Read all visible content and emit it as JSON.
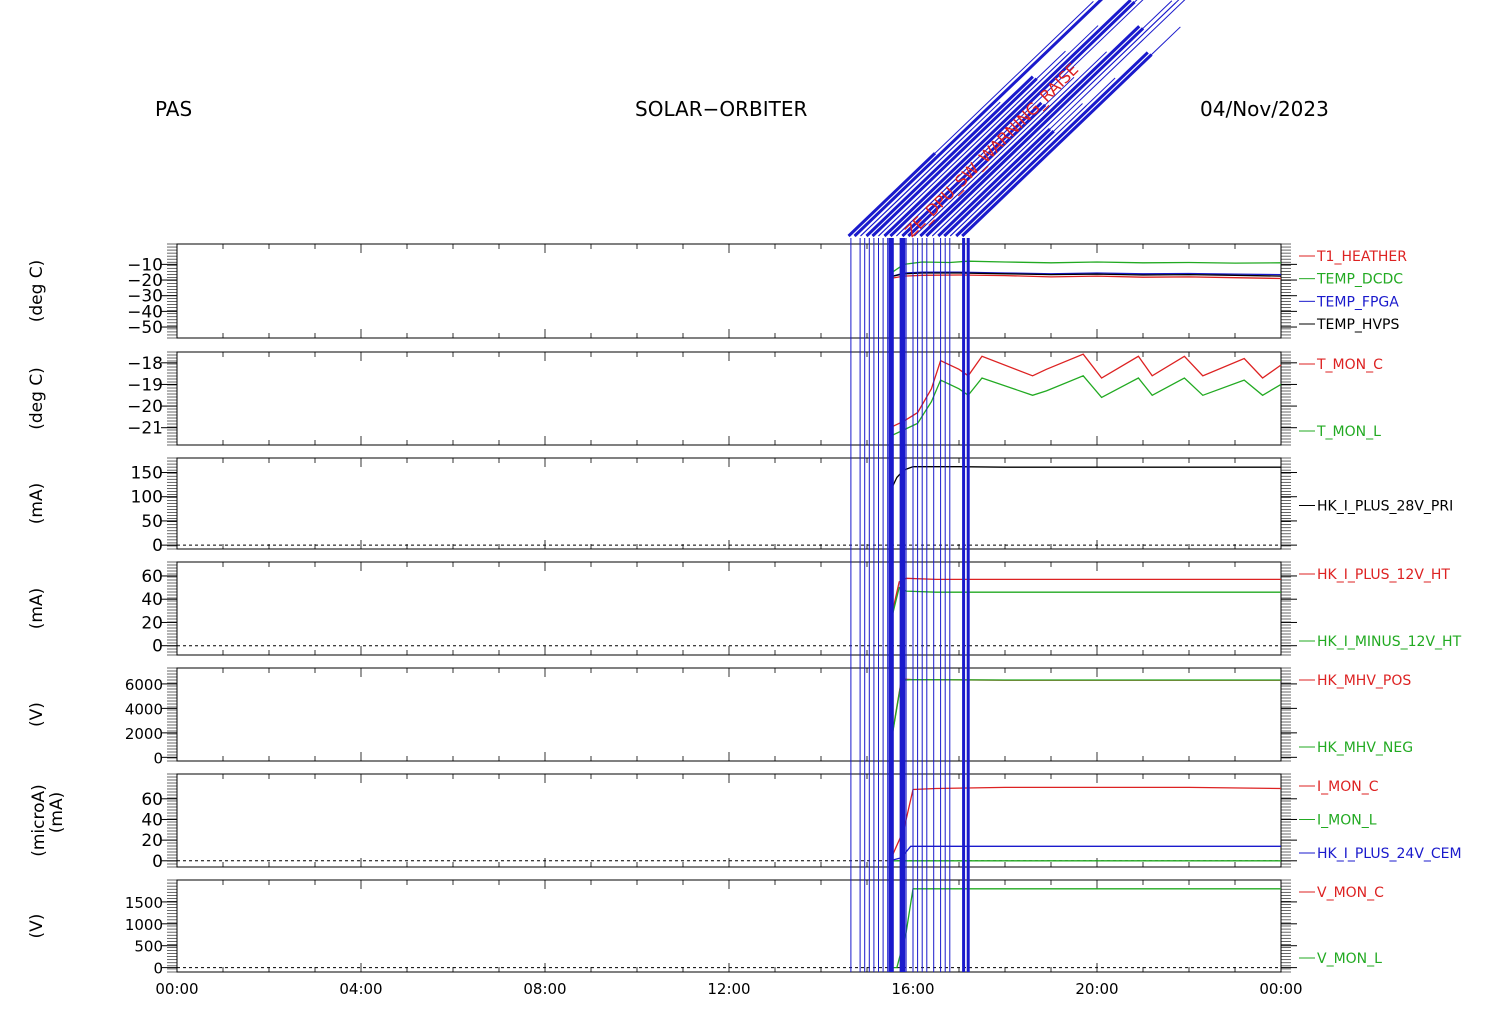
{
  "header": {
    "instrument": "PAS",
    "mission": "SOLAR−ORBITER",
    "date": "04/Nov/2023"
  },
  "colors": {
    "red": "#dd2222",
    "green": "#22aa22",
    "blue": "#1a1acc",
    "black": "#000000"
  },
  "event_labels": [
    {
      "time": 15.45,
      "text": "ZE_DPU_SW_WARNING_RAISE",
      "color": "red"
    }
  ],
  "event_lines": [
    14.65,
    14.85,
    14.95,
    15.05,
    15.15,
    15.25,
    15.35,
    15.45,
    15.55,
    15.72,
    15.85,
    16.0,
    16.1,
    16.2,
    16.3,
    16.45,
    16.6,
    16.7,
    16.8
  ],
  "event_lines_thick": [
    15.5,
    15.55,
    15.75,
    15.8,
    17.1,
    17.2
  ],
  "chart_data": [
    {
      "type": "line",
      "ylabel": "(deg C)",
      "ylim": [
        -57,
        3
      ],
      "yticks": [
        -10,
        -20,
        -30,
        -40,
        -50
      ],
      "ticklabels": [
        "−10",
        "−20",
        "−30",
        "−40",
        "−50"
      ],
      "xlim": [
        0,
        24
      ],
      "series": [
        {
          "name": "T1_HEATHER",
          "color": "red",
          "x": [
            15.5,
            15.8,
            16.2,
            17,
            18,
            19,
            20,
            21,
            22,
            23,
            24
          ],
          "y": [
            -19,
            -17.5,
            -17,
            -16.8,
            -17.2,
            -18,
            -17.5,
            -18.2,
            -18,
            -18.5,
            -19
          ]
        },
        {
          "name": "TEMP_DCDC",
          "color": "green",
          "x": [
            15.5,
            15.8,
            16.2,
            16.8,
            17.2,
            18,
            19,
            20,
            21,
            22,
            23,
            24
          ],
          "y": [
            -16,
            -10,
            -8.5,
            -8.8,
            -8,
            -8.5,
            -9,
            -8.5,
            -9,
            -8.8,
            -9.2,
            -9
          ]
        },
        {
          "name": "TEMP_FPGA",
          "color": "blue",
          "x": [
            15.5,
            15.8,
            16.2,
            17,
            18,
            19,
            20,
            21,
            22,
            23,
            24
          ],
          "y": [
            -18,
            -15.5,
            -15,
            -15,
            -15.5,
            -16,
            -15.5,
            -16,
            -15.8,
            -16.2,
            -16.5
          ]
        },
        {
          "name": "TEMP_HVPS",
          "color": "black",
          "x": [
            15.5,
            15.8,
            16.2,
            17,
            18,
            19,
            20,
            21,
            22,
            23,
            24
          ],
          "y": [
            -18,
            -16,
            -15.5,
            -15.5,
            -16,
            -16.5,
            -16.2,
            -16.8,
            -16.5,
            -17,
            -17.5
          ]
        }
      ]
    },
    {
      "type": "line",
      "ylabel": "(deg C)",
      "ylim": [
        -21.8,
        -17.5
      ],
      "yticks": [
        -18,
        -19,
        -20,
        -21
      ],
      "ticklabels": [
        "−18",
        "−19",
        "−20",
        "−21"
      ],
      "xlim": [
        0,
        24
      ],
      "series": [
        {
          "name": "T_MON_C",
          "color": "red",
          "x": [
            15.5,
            15.8,
            16.1,
            16.4,
            16.6,
            17.0,
            17.2,
            17.5,
            18.6,
            18.9,
            19.7,
            20.1,
            20.9,
            21.2,
            21.9,
            22.3,
            23.2,
            23.6,
            24.0
          ],
          "y": [
            -21,
            -20.7,
            -20.3,
            -19.2,
            -17.9,
            -18.3,
            -18.6,
            -17.7,
            -18.6,
            -18.3,
            -17.6,
            -18.7,
            -17.7,
            -18.6,
            -17.7,
            -18.6,
            -17.8,
            -18.7,
            -18.1
          ]
        },
        {
          "name": "T_MON_L",
          "color": "green",
          "x": [
            15.5,
            15.8,
            16.1,
            16.4,
            16.6,
            17.0,
            17.2,
            17.5,
            18.6,
            18.9,
            19.7,
            20.1,
            20.9,
            21.2,
            21.9,
            22.3,
            23.2,
            23.6,
            24.0
          ],
          "y": [
            -21.4,
            -21.1,
            -20.8,
            -19.8,
            -18.8,
            -19.2,
            -19.5,
            -18.7,
            -19.5,
            -19.3,
            -18.6,
            -19.6,
            -18.7,
            -19.5,
            -18.7,
            -19.5,
            -18.8,
            -19.5,
            -19.0
          ]
        }
      ]
    },
    {
      "type": "line",
      "ylabel": "(mA)",
      "ylim": [
        -8,
        180
      ],
      "yticks": [
        0,
        50,
        100,
        150
      ],
      "ticklabels": [
        "0",
        "50",
        "100",
        "150"
      ],
      "zero_line": true,
      "xlim": [
        0,
        24
      ],
      "series": [
        {
          "name": "HK_I_PLUS_28V_PRI",
          "color": "black",
          "x": [
            15.5,
            15.65,
            15.8,
            16.0,
            17,
            18,
            20,
            22,
            24
          ],
          "y": [
            110,
            140,
            155,
            162,
            162,
            161,
            161,
            161,
            161
          ]
        }
      ]
    },
    {
      "type": "line",
      "ylabel": "(mA)",
      "ylim": [
        -8,
        72
      ],
      "yticks": [
        0,
        20,
        40,
        60
      ],
      "ticklabels": [
        "0",
        "20",
        "40",
        "60"
      ],
      "zero_line": true,
      "xlim": [
        0,
        24
      ],
      "series": [
        {
          "name": "HK_I_PLUS_12V_HT",
          "color": "red",
          "x": [
            15.5,
            15.7,
            15.85,
            16.5,
            18,
            20,
            22,
            24
          ],
          "y": [
            20,
            55,
            58,
            57,
            57,
            57,
            57,
            57
          ]
        },
        {
          "name": "HK_I_MINUS_12V_HT",
          "color": "green",
          "x": [
            15.5,
            15.7,
            15.85,
            16.5,
            18,
            20,
            22,
            24
          ],
          "y": [
            18,
            50,
            47,
            46,
            46,
            46,
            46,
            46
          ]
        }
      ]
    },
    {
      "type": "line",
      "ylabel": "(V)",
      "ylim": [
        -300,
        7300
      ],
      "yticks": [
        0,
        2000,
        4000,
        6000
      ],
      "ticklabels": [
        "0",
        "2000",
        "4000",
        "6000"
      ],
      "xlim": [
        0,
        24
      ],
      "series": [
        {
          "name": "HK_MHV_POS",
          "color": "red",
          "x": [
            15.5,
            15.75,
            16.0,
            18,
            20,
            22,
            24
          ],
          "y": [
            800,
            6400,
            6350,
            6300,
            6300,
            6300,
            6300
          ]
        },
        {
          "name": "HK_MHV_NEG",
          "color": "green",
          "x": [
            15.5,
            15.75,
            16.0,
            18,
            20,
            22,
            24
          ],
          "y": [
            700,
            6300,
            6350,
            6320,
            6320,
            6320,
            6320
          ]
        }
      ]
    },
    {
      "type": "line",
      "ylabel": "(microA)",
      "ylabel2": "(mA)",
      "ylim": [
        -6,
        84
      ],
      "yticks": [
        0,
        20,
        40,
        60
      ],
      "ticklabels": [
        "0",
        "20",
        "40",
        "60"
      ],
      "zero_line": true,
      "xlim": [
        0,
        24
      ],
      "series": [
        {
          "name": "I_MON_C",
          "color": "red",
          "x": [
            15.5,
            15.8,
            16.0,
            16.5,
            18,
            20,
            22,
            24
          ],
          "y": [
            0,
            30,
            69,
            70,
            71,
            71,
            71,
            70
          ]
        },
        {
          "name": "I_MON_L",
          "color": "green",
          "x": [
            15.5,
            24
          ],
          "y": [
            0,
            0
          ]
        },
        {
          "name": "HK_I_PLUS_24V_CEM",
          "color": "blue",
          "x": [
            15.5,
            15.75,
            15.95,
            17,
            20,
            24
          ],
          "y": [
            0,
            3,
            14,
            14,
            14,
            14
          ]
        }
      ]
    },
    {
      "type": "line",
      "ylabel": "(V)",
      "ylim": [
        -100,
        2000
      ],
      "yticks": [
        0,
        500,
        1000,
        1500
      ],
      "ticklabels": [
        "0",
        "500",
        "1000",
        "1500"
      ],
      "zero_line": true,
      "xlim": [
        0,
        24
      ],
      "series": [
        {
          "name": "V_MON_C",
          "color": "red",
          "x": [],
          "y": []
        },
        {
          "name": "V_MON_L",
          "color": "green",
          "x": [
            15.5,
            15.65,
            15.85,
            16.0,
            18,
            20,
            24
          ],
          "y": [
            0,
            0,
            800,
            1800,
            1800,
            1800,
            1800
          ]
        }
      ]
    }
  ],
  "xaxis": {
    "ticks": [
      0,
      4,
      8,
      12,
      16,
      20,
      24
    ],
    "ticklabels": [
      "00:00",
      "04:00",
      "08:00",
      "12:00",
      "16:00",
      "20:00",
      "00:00"
    ]
  }
}
